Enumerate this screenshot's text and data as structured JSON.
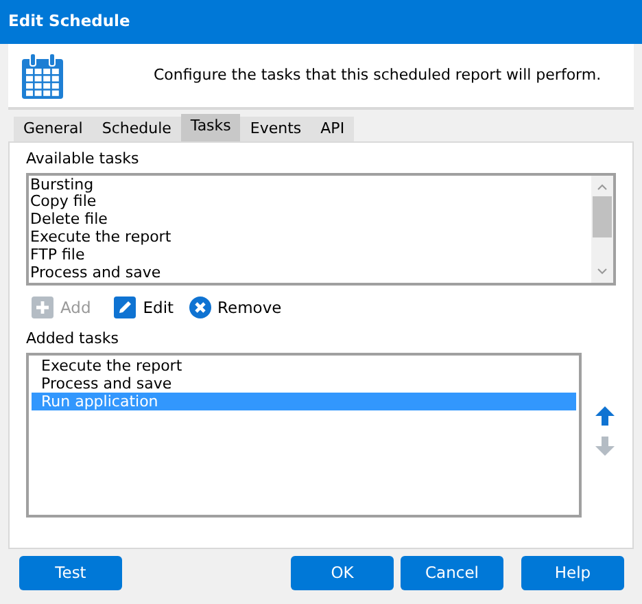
{
  "window": {
    "title": "Edit Schedule"
  },
  "header": {
    "text": "Configure the tasks that this scheduled report will perform."
  },
  "tabs": [
    {
      "label": "General",
      "selected": false
    },
    {
      "label": "Schedule",
      "selected": false
    },
    {
      "label": "Tasks",
      "selected": true
    },
    {
      "label": "Events",
      "selected": false
    },
    {
      "label": "API",
      "selected": false
    }
  ],
  "available_tasks": {
    "label": "Available tasks",
    "items": [
      "Bursting",
      "Copy file",
      "Delete file",
      "Execute the report",
      "FTP file",
      "Process and save"
    ]
  },
  "actions": [
    {
      "kind": "add",
      "label": "Add",
      "disabled": true
    },
    {
      "kind": "edit",
      "label": "Edit",
      "disabled": false
    },
    {
      "kind": "remove",
      "label": "Remove",
      "disabled": false
    }
  ],
  "added_tasks": {
    "label": "Added tasks",
    "items": [
      {
        "label": "Execute the report",
        "selected": false
      },
      {
        "label": "Process and save",
        "selected": false
      },
      {
        "label": "Run application",
        "selected": true
      }
    ]
  },
  "move_buttons": [
    {
      "kind": "up",
      "disabled": false
    },
    {
      "kind": "down",
      "disabled": true
    }
  ],
  "buttons": [
    {
      "label": "Test"
    },
    {
      "label": "OK"
    },
    {
      "label": "Cancel"
    },
    {
      "label": "Help"
    }
  ]
}
